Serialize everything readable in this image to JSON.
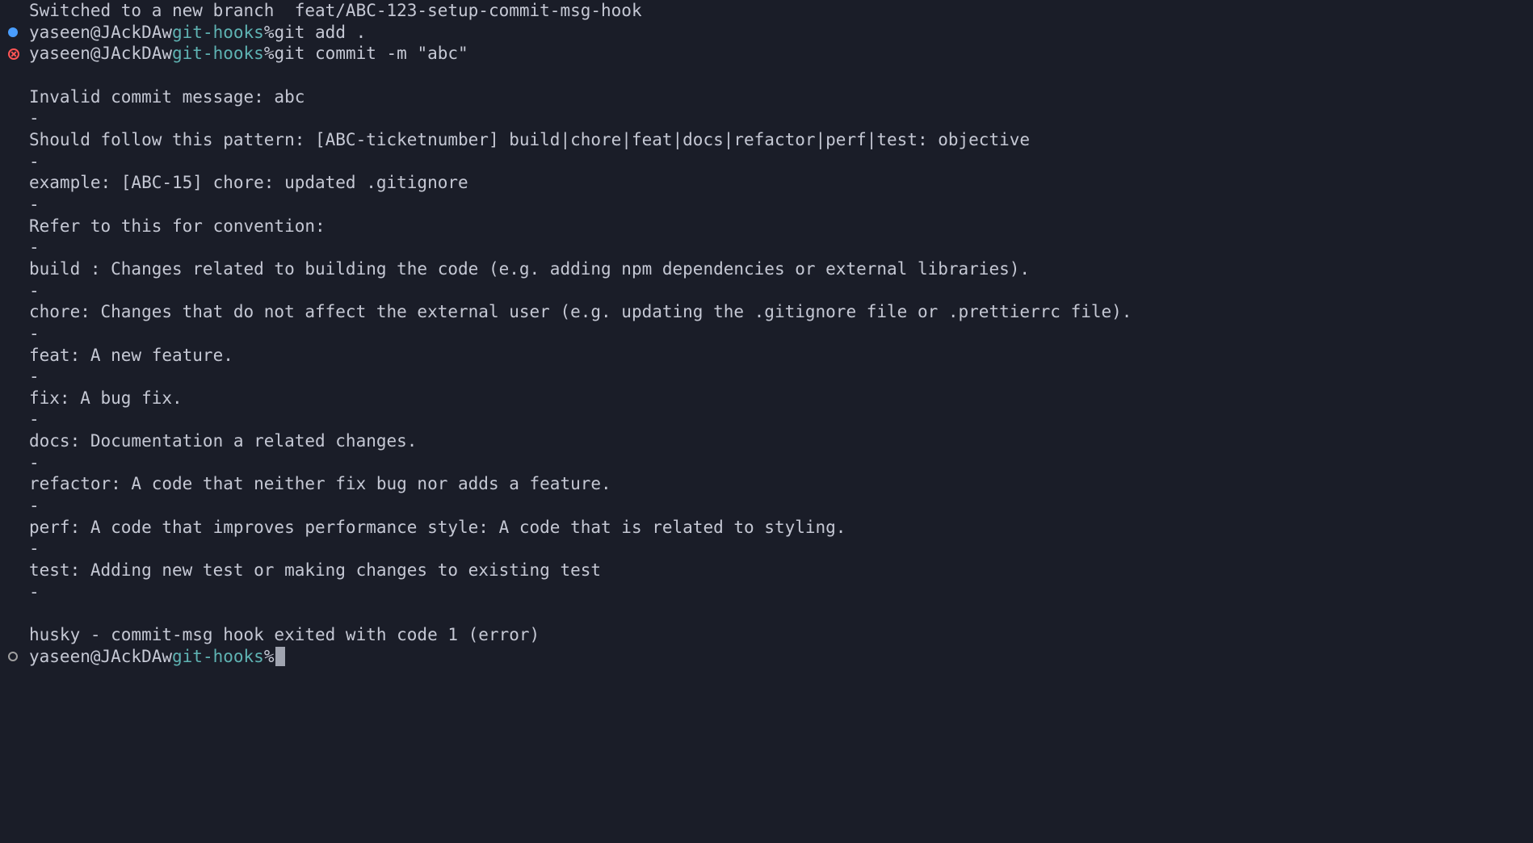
{
  "lines": {
    "cutoff": "Switched to a new branch  feat/ABC-123-setup-commit-msg-hook",
    "prompt1": {
      "user": "yaseen@JAckDAw",
      "dir": "git-hooks",
      "symbol": "%",
      "command": "git add ."
    },
    "prompt2": {
      "user": "yaseen@JAckDAw",
      "dir": "git-hooks",
      "symbol": "%",
      "command": "git commit -m \"abc\""
    },
    "output": [
      "",
      "Invalid commit message: abc",
      "-",
      "Should follow this pattern: [ABC-ticketnumber] build|chore|feat|docs|refactor|perf|test: objective",
      "-",
      "example: [ABC-15] chore: updated .gitignore",
      "-",
      "Refer to this for convention:",
      "-",
      "build : Changes related to building the code (e.g. adding npm dependencies or external libraries).",
      "-",
      "chore: Changes that do not affect the external user (e.g. updating the .gitignore file or .prettierrc file).",
      "-",
      "feat: A new feature.",
      "-",
      "fix: A bug fix.",
      "-",
      "docs: Documentation a related changes.",
      "-",
      "refactor: A code that neither fix bug nor adds a feature.",
      "-",
      "perf: A code that improves performance style: A code that is related to styling.",
      "-",
      "test: Adding new test or making changes to existing test",
      "-",
      "",
      "husky - commit-msg hook exited with code 1 (error)"
    ],
    "prompt3": {
      "user": "yaseen@JAckDAw",
      "dir": "git-hooks",
      "symbol": "%",
      "command": ""
    }
  }
}
